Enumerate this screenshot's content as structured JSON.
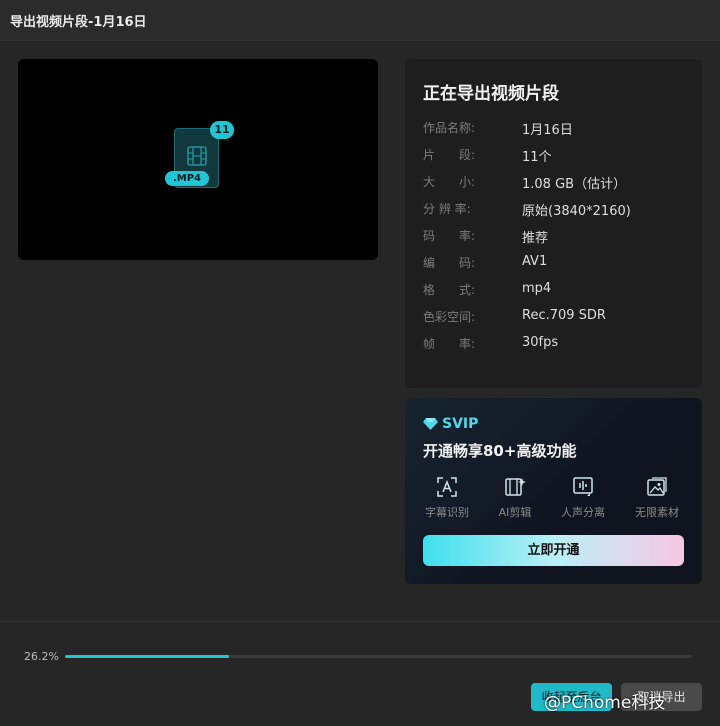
{
  "window": {
    "title": "导出视频片段-1月16日"
  },
  "preview": {
    "count_badge": "11",
    "file_ext": ".MP4",
    "icon": "film-icon"
  },
  "info": {
    "title": "正在导出视频片段",
    "rows": [
      {
        "label": "作品名称:",
        "value": "1月16日"
      },
      {
        "label": "片　　段:",
        "value": "11个"
      },
      {
        "label": "大　　小:",
        "value": "1.08 GB（估计）"
      },
      {
        "label": "分 辨 率:",
        "value": "原始(3840*2160)"
      },
      {
        "label": "码　　率:",
        "value": "推荐"
      },
      {
        "label": "编　　码:",
        "value": "AV1"
      },
      {
        "label": "格　　式:",
        "value": "mp4"
      },
      {
        "label": "色彩空间:",
        "value": "Rec.709 SDR"
      },
      {
        "label": "帧　　率:",
        "value": "30fps"
      }
    ]
  },
  "vip": {
    "tag": "SVIP",
    "tag_icon": "diamond-icon",
    "headline": "开通畅享80+高级功能",
    "features": [
      {
        "label": "字幕识别",
        "icon": "subtitle-recognition-icon"
      },
      {
        "label": "AI剪辑",
        "icon": "ai-edit-icon"
      },
      {
        "label": "人声分离",
        "icon": "voice-separation-icon"
      },
      {
        "label": "无限素材",
        "icon": "unlimited-assets-icon"
      }
    ],
    "button_label": "立即开通"
  },
  "progress": {
    "text": "26.2%",
    "value": 26.2
  },
  "footer": {
    "primary_label": "收起至后台",
    "secondary_label": "取消导出"
  },
  "watermark": {
    "text": "@PChome科技"
  },
  "colors": {
    "accent": "#21c6d4",
    "background": "#262626",
    "panel": "#1e1e1e"
  }
}
